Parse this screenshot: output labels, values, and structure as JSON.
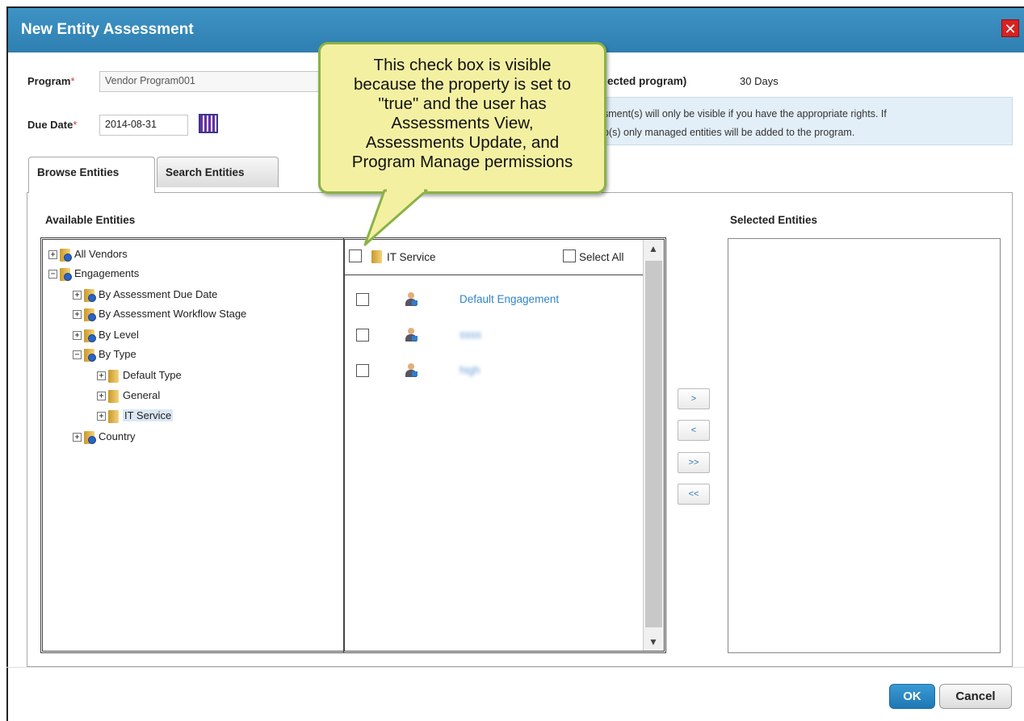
{
  "dialog": {
    "title": "New Entity Assessment",
    "close_label": "✕"
  },
  "form": {
    "program_label": "Program",
    "program_required": "*",
    "program_value": "Vendor Program001",
    "due_date_label": "Due Date",
    "due_date_required": "*",
    "due_date_value": "2014-08-31",
    "selected_program_label_fragment": "ected program)",
    "selected_program_value": "30 Days"
  },
  "info": {
    "line1": "sment(s) will only be visible if you have the appropriate rights. If",
    "line2": "p(s) only managed entities will be added to the program."
  },
  "tabs": [
    {
      "label": "Browse Entities",
      "active": true
    },
    {
      "label": "Search Entities",
      "active": false
    }
  ],
  "available": {
    "heading": "Available Entities",
    "tree": [
      {
        "label": "All Vendors",
        "toggle": "+",
        "icon": "search-folder"
      },
      {
        "label": "Engagements",
        "toggle": "−",
        "icon": "search-folder"
      },
      {
        "label": "By Assessment Due Date",
        "toggle": "+",
        "icon": "search-folder"
      },
      {
        "label": "By Assessment Workflow Stage",
        "toggle": "+",
        "icon": "search-folder"
      },
      {
        "label": "By Level",
        "toggle": "+",
        "icon": "search-folder"
      },
      {
        "label": "By Type",
        "toggle": "−",
        "icon": "search-folder"
      },
      {
        "label": "Default Type",
        "toggle": "+",
        "icon": "folder"
      },
      {
        "label": "General",
        "toggle": "+",
        "icon": "folder"
      },
      {
        "label": "IT Service",
        "toggle": "+",
        "icon": "folder",
        "selected": true
      },
      {
        "label": "Country",
        "toggle": "+",
        "icon": "search-folder"
      }
    ]
  },
  "list": {
    "folder_label": "IT Service",
    "select_all_label": "Select All",
    "rows": [
      {
        "label": "Default Engagement",
        "blurred": false
      },
      {
        "label": "ssss",
        "blurred": true
      },
      {
        "label": "high",
        "blurred": true
      }
    ]
  },
  "move_buttons": {
    "add": ">",
    "remove": "<",
    "add_all": ">>",
    "remove_all": "<<"
  },
  "selected": {
    "heading": "Selected Entities"
  },
  "footer": {
    "ok": "OK",
    "cancel": "Cancel"
  },
  "callout": {
    "text": "This check box is visible\nbecause the property is set to\n\"true\" and the user has\nAssessments View,\nAssessments Update, and\nProgram Manage permissions"
  },
  "colors": {
    "titlebar": "#3489bc",
    "link": "#2f84c7",
    "callout_fill": "#f4f0a2",
    "callout_border": "#8ab246",
    "ok_button": "#1f77b4"
  }
}
